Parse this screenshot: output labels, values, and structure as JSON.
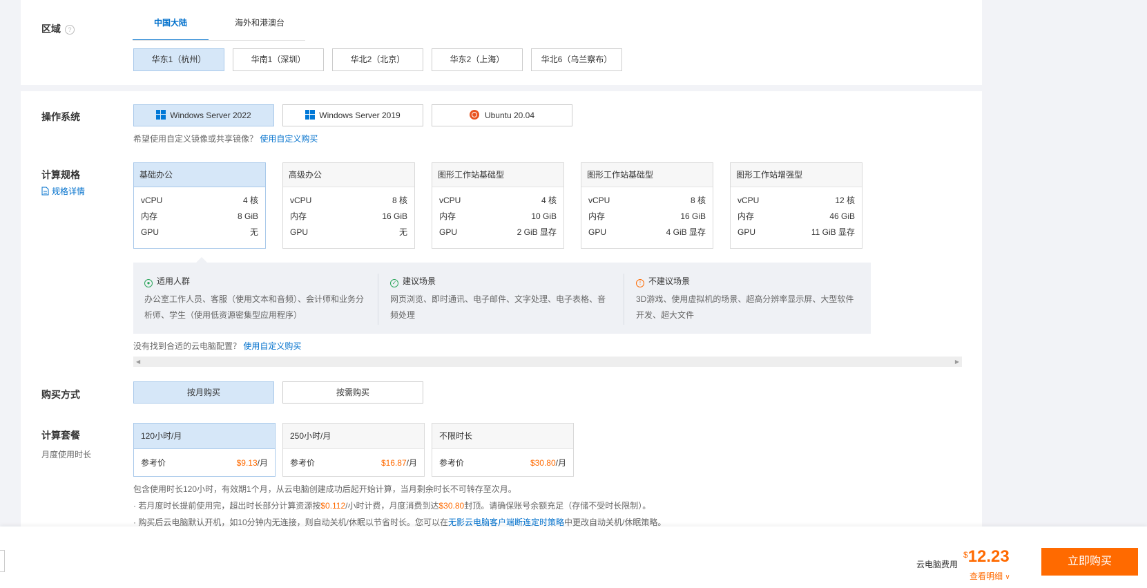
{
  "region": {
    "label": "区域",
    "help_icon": "?",
    "tabs": [
      {
        "label": "中国大陆",
        "active": true
      },
      {
        "label": "海外和港澳台",
        "active": false
      }
    ],
    "options": [
      {
        "label": "华东1（杭州）",
        "selected": true
      },
      {
        "label": "华南1（深圳）",
        "selected": false
      },
      {
        "label": "华北2（北京）",
        "selected": false
      },
      {
        "label": "华东2（上海）",
        "selected": false
      },
      {
        "label": "华北6（乌兰察布）",
        "selected": false
      }
    ]
  },
  "os": {
    "label": "操作系统",
    "options": [
      {
        "label": "Windows Server 2022",
        "icon": "windows-icon",
        "selected": true
      },
      {
        "label": "Windows Server 2019",
        "icon": "windows-icon",
        "selected": false
      },
      {
        "label": "Ubuntu 20.04",
        "icon": "ubuntu-icon",
        "selected": false
      }
    ],
    "hint": "希望使用自定义镜像或共享镜像？",
    "hint_link": "使用自定义购买"
  },
  "spec": {
    "label": "计算规格",
    "detail_link": "规格详情",
    "cards": [
      {
        "name": "基础办公",
        "vcpu": "4 核",
        "mem": "8 GiB",
        "gpu": "无",
        "selected": true
      },
      {
        "name": "高级办公",
        "vcpu": "8 核",
        "mem": "16 GiB",
        "gpu": "无",
        "selected": false
      },
      {
        "name": "图形工作站基础型",
        "vcpu": "4 核",
        "mem": "10 GiB",
        "gpu": "2 GiB 显存",
        "selected": false
      },
      {
        "name": "图形工作站基础型",
        "vcpu": "8 核",
        "mem": "16 GiB",
        "gpu": "4 GiB 显存",
        "selected": false
      },
      {
        "name": "图形工作站增强型",
        "vcpu": "12 核",
        "mem": "46 GiB",
        "gpu": "11 GiB 显存",
        "selected": false
      }
    ],
    "row_labels": {
      "vcpu": "vCPU",
      "mem": "内存",
      "gpu": "GPU"
    },
    "desc": [
      {
        "title": "适用人群",
        "text": "办公室工作人员、客服（使用文本和音频）、会计师和业务分析师、学生（使用低资源密集型应用程序）",
        "color": "#2aa55a"
      },
      {
        "title": "建议场景",
        "text": "网页浏览、即时通讯、电子邮件、文字处理、电子表格、音频处理",
        "color": "#2aa55a"
      },
      {
        "title": "不建议场景",
        "text": "3D游戏、使用虚拟机的场景、超高分辨率显示屏、大型软件开发、超大文件",
        "color": "#ff6a00"
      }
    ],
    "hint": "没有找到合适的云电脑配置？",
    "hint_link": "使用自定义购买"
  },
  "purchase": {
    "label": "购买方式",
    "options": [
      {
        "label": "按月购买",
        "selected": true
      },
      {
        "label": "按需购买",
        "selected": false
      }
    ]
  },
  "package": {
    "label": "计算套餐",
    "sublabel": "月度使用时长",
    "options": [
      {
        "name": "120小时/月",
        "ref_label": "参考价",
        "price": "$9.13",
        "unit": "/月",
        "selected": true
      },
      {
        "name": "250小时/月",
        "ref_label": "参考价",
        "price": "$16.87",
        "unit": "/月",
        "selected": false
      },
      {
        "name": "不限时长",
        "ref_label": "参考价",
        "price": "$30.80",
        "unit": "/月",
        "selected": false
      }
    ],
    "note1": "包含使用时长120小时，有效期1个月，从云电脑创建成功后起开始计算，当月剩余时长不可转存至次月。",
    "note2_a": "· 若月度时长提前使用完，超出时长部分计算资源按",
    "note2_price": "$0.112",
    "note2_b": "/小时计费，月度消费到达",
    "note2_cap": "$30.80",
    "note2_c": "封顶。请确保账号余额充足（存储不受时长限制）。",
    "note3_a": "· 购买后云电脑默认开机，如10分钟内无连接，则自动关机/休眠以节省时长。您可以在",
    "note3_link": "无影云电脑客户端断连定时策略",
    "note3_b": "中更改自动关机/休眠策略。"
  },
  "footer": {
    "fee_label": "云电脑费用",
    "currency": "$",
    "price": "12.23",
    "detail_link": "查看明细",
    "buy_button": "立即购买"
  },
  "colors": {
    "accent": "#0070cc",
    "orange": "#ff6a00",
    "selected_bg": "#d6e7f8"
  }
}
